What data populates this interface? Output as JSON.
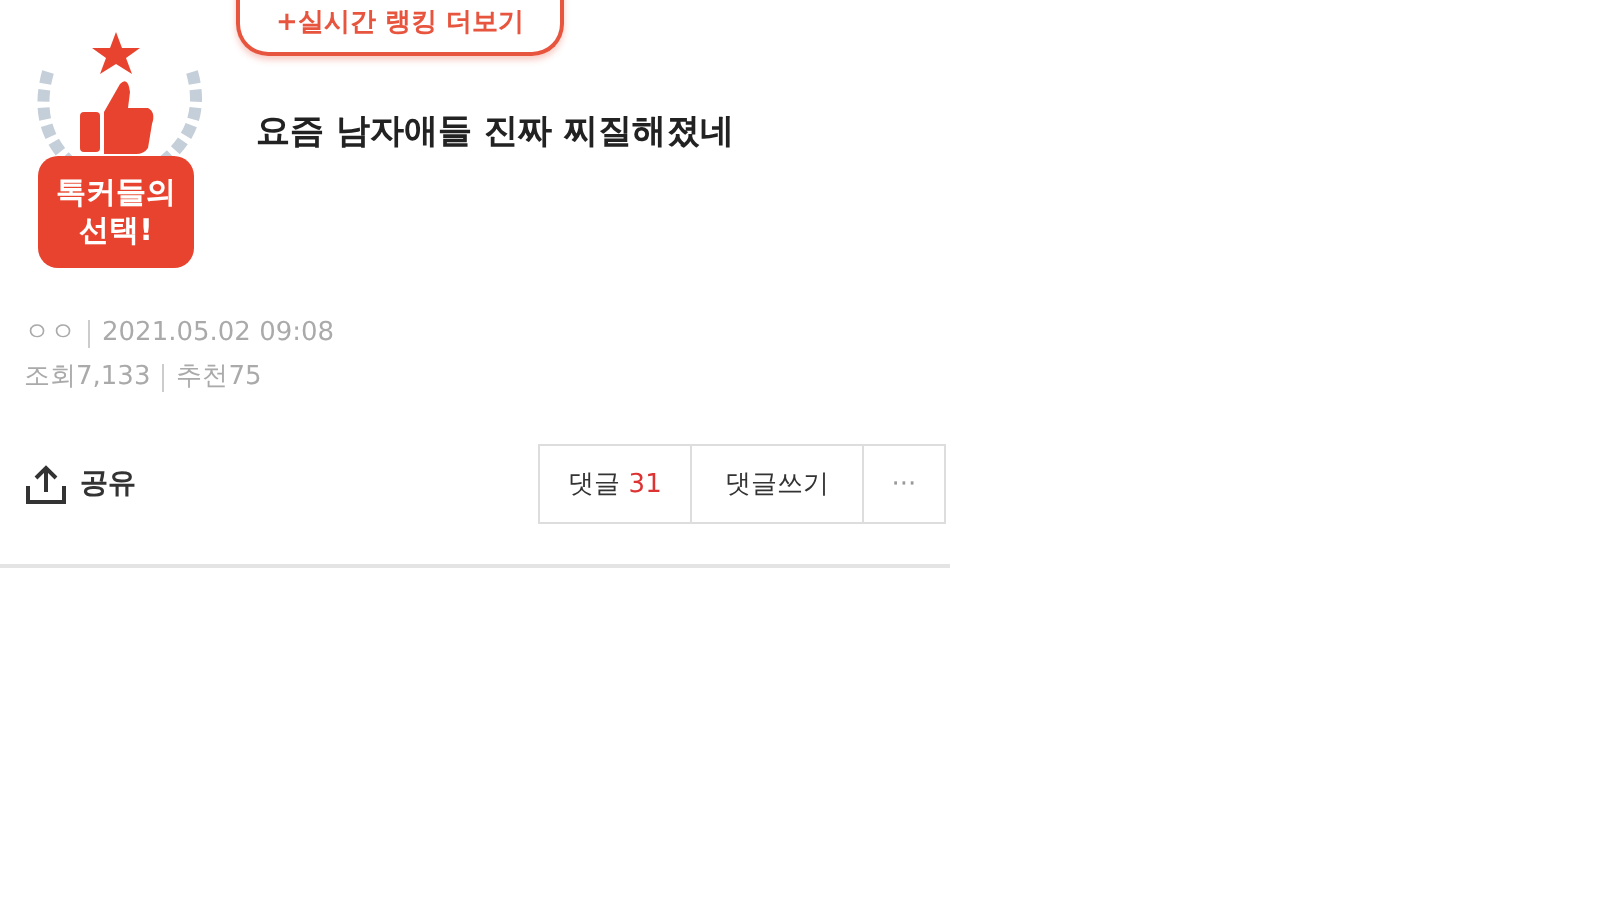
{
  "badge": {
    "label": "톡커들의 선택!"
  },
  "ranking_link": "+실시간 랭킹 더보기",
  "post": {
    "title": "요즘 남자애들 진짜 찌질해졌네",
    "author": "ㅇㅇ",
    "date": "2021.05.02 09:08",
    "views_label": "조회",
    "views": "7,133",
    "likes_label": "추천",
    "likes": "75"
  },
  "share": "공유",
  "actions": {
    "comments_label": "댓글",
    "comments_count": "31",
    "write_comment": "댓글쓰기",
    "more": "···"
  }
}
